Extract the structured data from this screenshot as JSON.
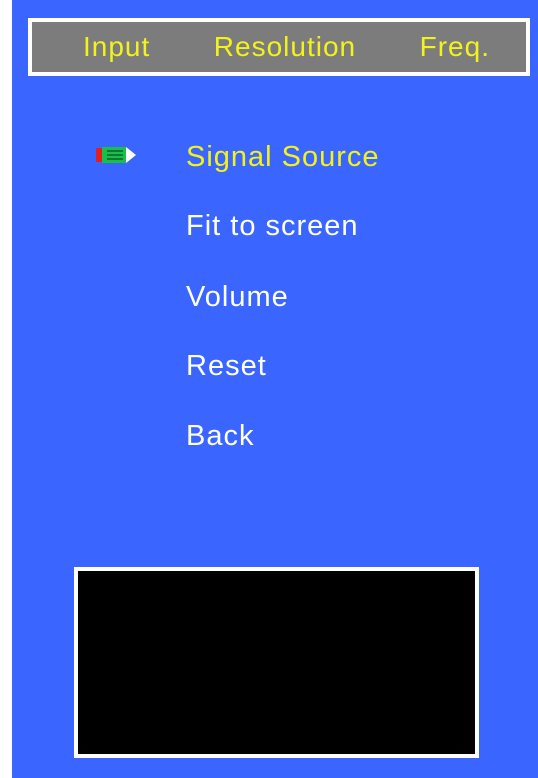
{
  "header": {
    "input": "Input",
    "resolution": "Resolution",
    "freq": "Freq."
  },
  "menu": {
    "selected_index": 0,
    "items": [
      {
        "label": "Signal Source"
      },
      {
        "label": "Fit to screen"
      },
      {
        "label": "Volume"
      },
      {
        "label": "Reset"
      },
      {
        "label": "Back"
      }
    ]
  },
  "icons": {
    "pointer": "pencil-pointer-icon"
  },
  "colors": {
    "background": "#3a66ff",
    "header_bg": "#7c7c7c",
    "header_text": "#f2f21c",
    "selected_text": "#f2f21c",
    "text": "#ffffff",
    "preview_bg": "#000000"
  }
}
